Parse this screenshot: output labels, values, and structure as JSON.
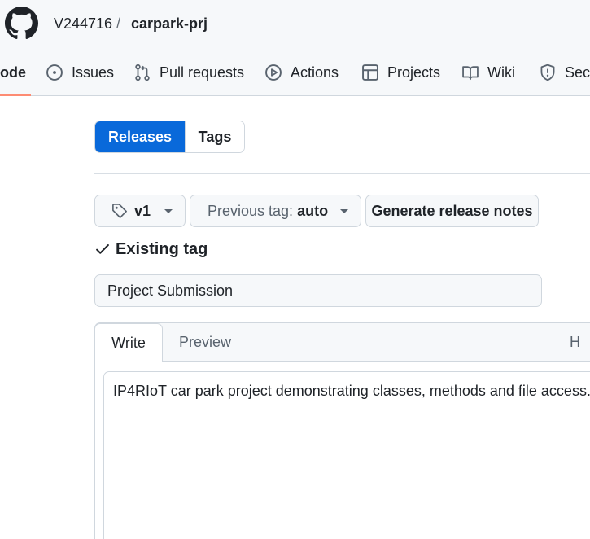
{
  "header": {
    "owner": "V244716",
    "separator": "/",
    "repo": "carpark-prj"
  },
  "nav": {
    "tabs": [
      {
        "label": "ode",
        "icon": "code-icon",
        "active": true
      },
      {
        "label": "Issues",
        "icon": "issue-opened-icon"
      },
      {
        "label": "Pull requests",
        "icon": "git-pull-request-icon"
      },
      {
        "label": "Actions",
        "icon": "play-icon"
      },
      {
        "label": "Projects",
        "icon": "table-icon"
      },
      {
        "label": "Wiki",
        "icon": "book-icon"
      },
      {
        "label": "Secu",
        "icon": "shield-icon"
      }
    ],
    "active_color": "#fd8c73"
  },
  "segmented": {
    "releases_label": "Releases",
    "tags_label": "Tags",
    "active_color": "#0969da"
  },
  "release_form": {
    "tag_value": "v1",
    "previous_tag_label": "Previous tag:",
    "previous_tag_value": "auto",
    "generate_notes_label": "Generate release notes",
    "tag_status": "Existing tag",
    "title_value": "Project Submission",
    "editor": {
      "write_tab": "Write",
      "preview_tab": "Preview",
      "heading_tool": "H",
      "body_value": "IP4RIoT car park project demonstrating classes, methods and file access."
    }
  }
}
